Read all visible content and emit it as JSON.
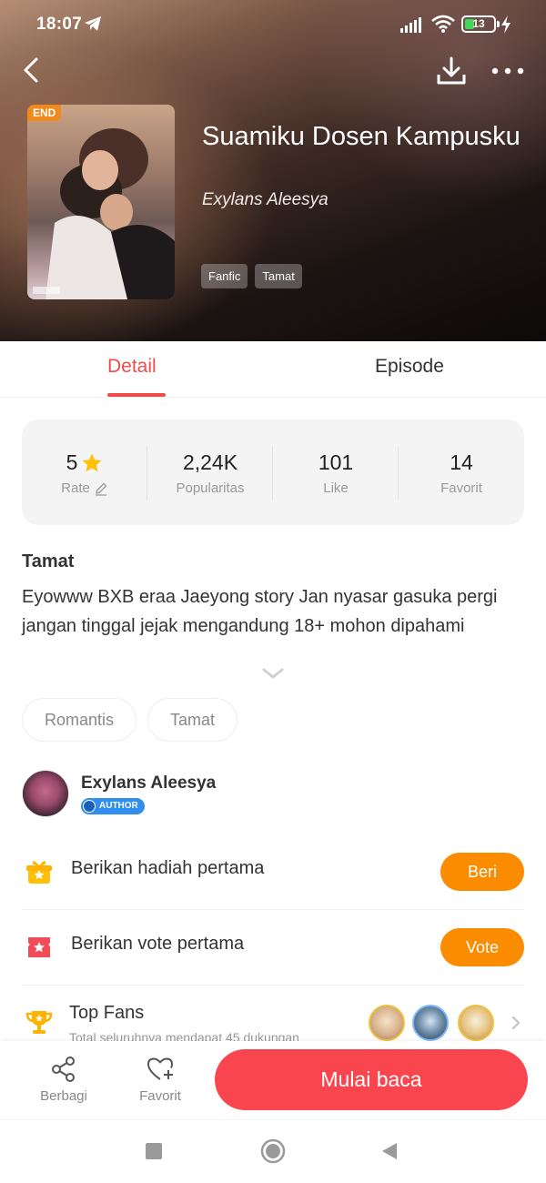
{
  "status_bar": {
    "time": "18:07",
    "battery": "13"
  },
  "book": {
    "title": "Suamiku Dosen Kampusku",
    "author": "Exylans Aleesya",
    "badge": "END",
    "tags": [
      "Fanfic",
      "Tamat"
    ]
  },
  "tabs": {
    "detail": "Detail",
    "episode": "Episode"
  },
  "stats": {
    "rate_value": "5",
    "rate_label": "Rate",
    "popularity_value": "2,24K",
    "popularity_label": "Popularitas",
    "like_value": "101",
    "like_label": "Like",
    "favorite_value": "14",
    "favorite_label": "Favorit"
  },
  "description": {
    "status": "Tamat",
    "text": "Eyowww BXB eraa Jaeyong story Jan nyasar gasuka pergi jangan tinggal jejak mengandung 18+ mohon dipahami"
  },
  "genres": [
    "Romantis",
    "Tamat"
  ],
  "author_section": {
    "name": "Exylans Aleesya",
    "badge": "AUTHOR"
  },
  "gift_row": {
    "text": "Berikan hadiah pertama",
    "button": "Beri"
  },
  "vote_row": {
    "text": "Berikan vote pertama",
    "button": "Vote"
  },
  "top_fans": {
    "title": "Top Fans",
    "subtitle": "Total seluruhnya mendapat 45 dukungan"
  },
  "bottom_bar": {
    "share": "Berbagi",
    "favorite": "Favorit",
    "read": "Mulai baca"
  },
  "colors": {
    "accent_red": "#f9454d",
    "tab_red": "#ef4b4b",
    "orange": "#fb8c00",
    "star": "#ffc107"
  }
}
